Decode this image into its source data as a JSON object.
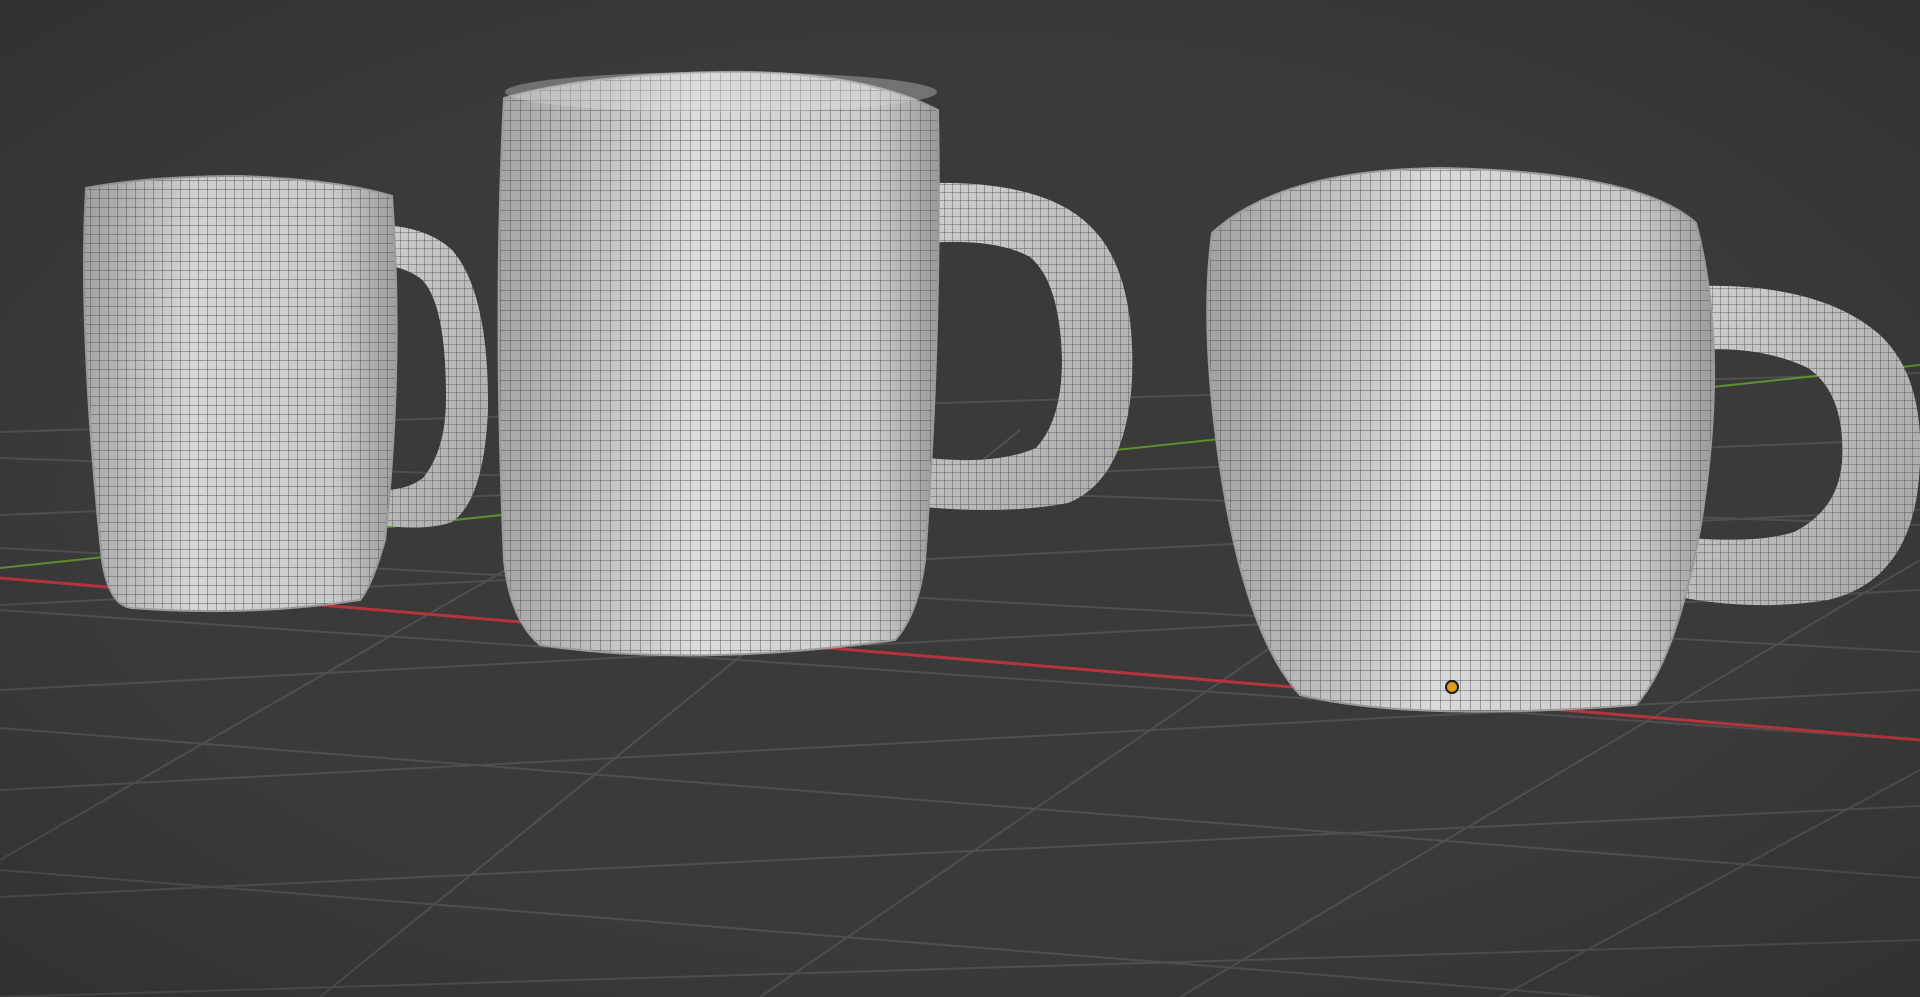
{
  "viewport": {
    "mode": "solid",
    "show_wireframe": true,
    "background_color": "#3a3a3a",
    "grid_color": "#4f4f4f",
    "x_axis_color": "#b5343d",
    "y_axis_color": "#5f8f2e",
    "mesh_color": "#cdcdcd",
    "wire_color": "#4b4b4b",
    "origin_color": "#e39a22"
  },
  "objects": [
    {
      "name": "mug-left",
      "type": "mesh",
      "selected": false
    },
    {
      "name": "mug-middle",
      "type": "mesh",
      "selected": false
    },
    {
      "name": "mug-right",
      "type": "mesh",
      "selected": false
    }
  ],
  "origin": {
    "visible": true,
    "icon": "object-origin-dot"
  }
}
